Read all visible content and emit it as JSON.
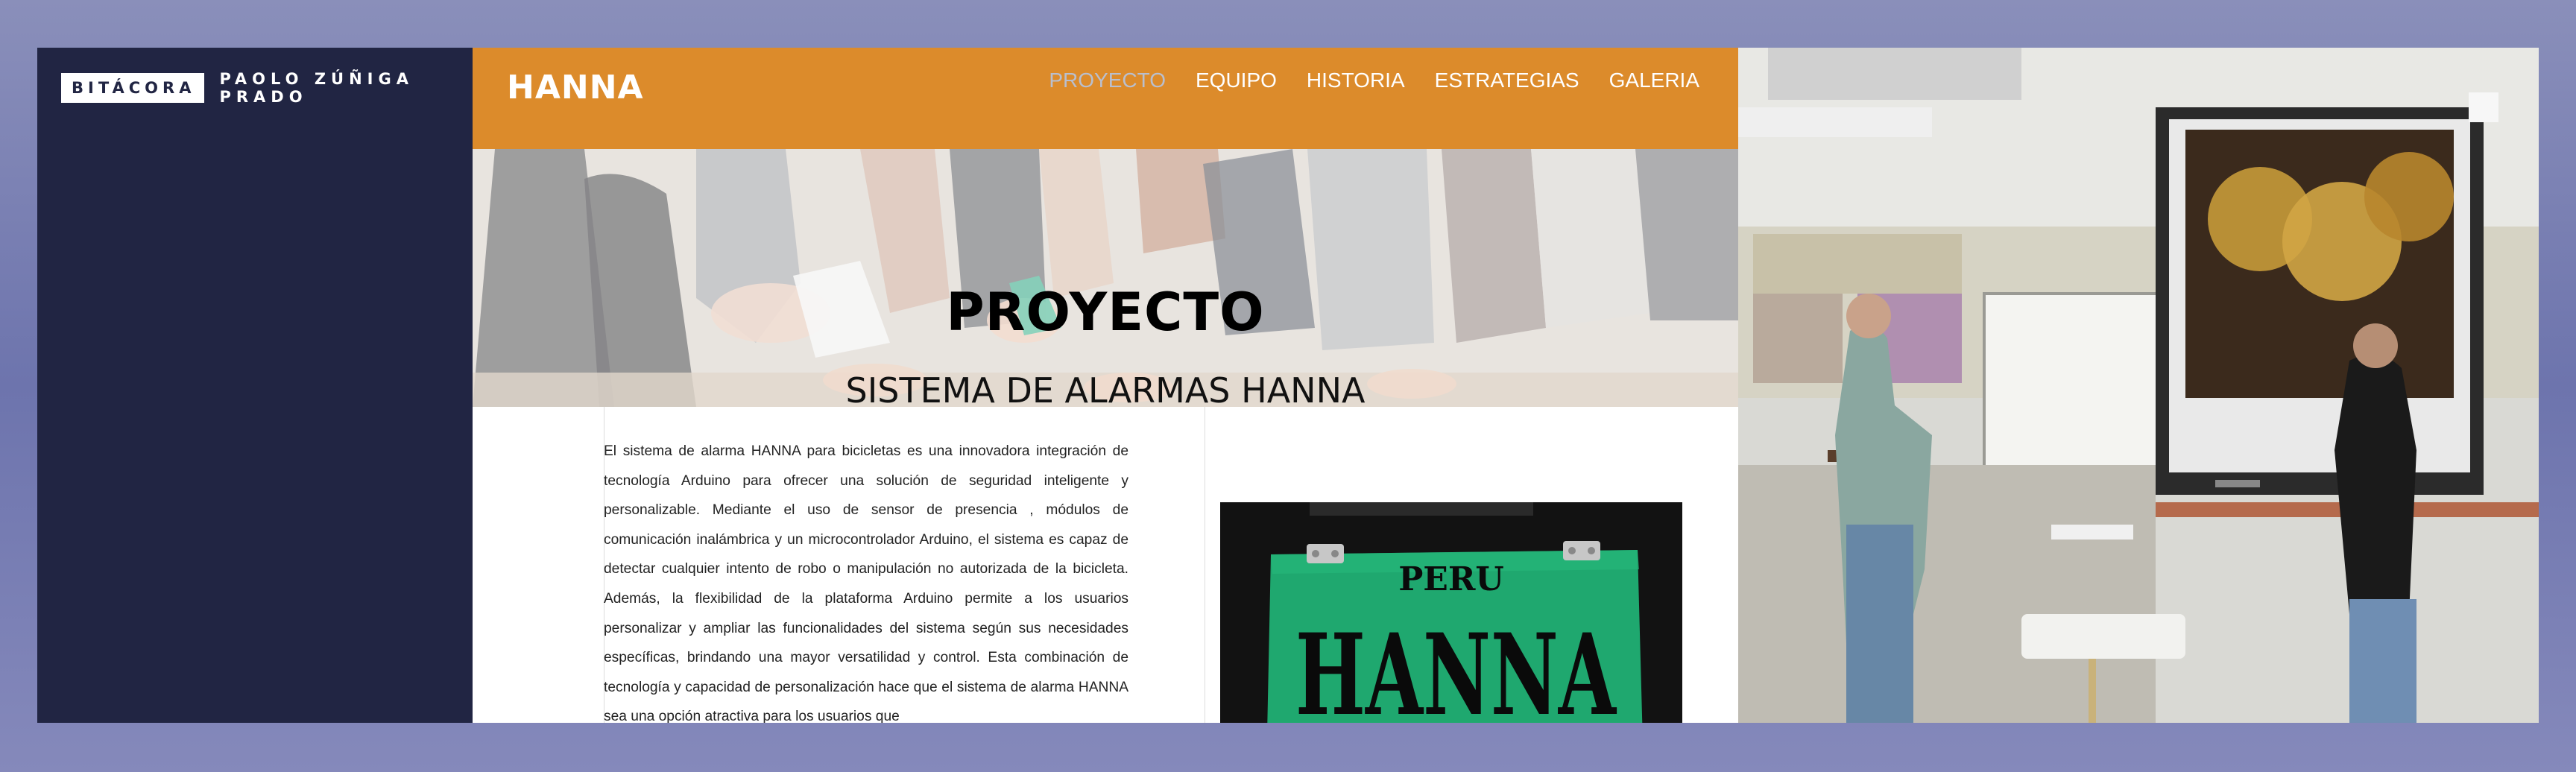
{
  "sidebar": {
    "brand_box": "BITÁCORA",
    "brand_name": "PAOLO ZÚÑIGA PRADO"
  },
  "header": {
    "logo": "HANNA",
    "nav": [
      "PROYECTO",
      "EQUIPO",
      "HISTORIA",
      "ESTRATEGIAS",
      "GALERIA"
    ],
    "active_nav": "PROYECTO"
  },
  "hero": {
    "title": "PROYECTO",
    "subtitle": "SISTEMA DE ALARMAS HANNA"
  },
  "content": {
    "paragraph": "El sistema de alarma HANNA para bicicletas es una innovadora integración de tecnología Arduino para ofrecer una solución de seguridad inteligente y personalizable. Mediante el uso de sensor de presencia , módulos de comunicación inalámbrica y un microcontrolador Arduino, el sistema es capaz de detectar cualquier intento de robo o manipulación no autorizada de la bicicleta. Además, la flexibilidad de la plataforma Arduino permite a los usuarios personalizar y ampliar las funcionalidades del sistema según sus necesidades específicas, brindando una mayor versatilidad y control. Esta combinación de tecnología y capacidad de personalización hace que el sistema de alarma HANNA sea una opción atractiva para los usuarios que"
  },
  "sign": {
    "top": "PERU",
    "main": "HANNA"
  },
  "colors": {
    "sidebar": "#212543",
    "header": "#dc8b2b",
    "active_nav": "#b9bfce",
    "sign_green": "#1fa86f"
  }
}
